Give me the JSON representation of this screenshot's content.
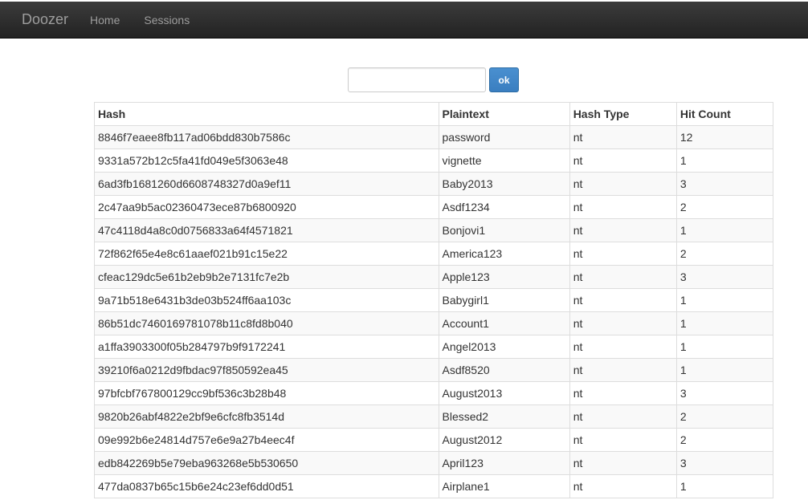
{
  "navbar": {
    "brand": "Doozer",
    "links": [
      "Home",
      "Sessions"
    ]
  },
  "search": {
    "value": "",
    "placeholder": "",
    "button_label": "ok",
    "button_color": "#428bca"
  },
  "table": {
    "headers": [
      "Hash",
      "Plaintext",
      "Hash Type",
      "Hit Count"
    ],
    "rows": [
      [
        "8846f7eaee8fb117ad06bdd830b7586c",
        "password",
        "nt",
        "12"
      ],
      [
        "9331a572b12c5fa41fd049e5f3063e48",
        "vignette",
        "nt",
        "1"
      ],
      [
        "6ad3fb1681260d6608748327d0a9ef11",
        "Baby2013",
        "nt",
        "3"
      ],
      [
        "2c47aa9b5ac02360473ece87b6800920",
        "Asdf1234",
        "nt",
        "2"
      ],
      [
        "47c4118d4a8c0d0756833a64f4571821",
        "Bonjovi1",
        "nt",
        "1"
      ],
      [
        "72f862f65e4e8c61aaef021b91c15e22",
        "America123",
        "nt",
        "2"
      ],
      [
        "cfeac129dc5e61b2eb9b2e7131fc7e2b",
        "Apple123",
        "nt",
        "3"
      ],
      [
        "9a71b518e6431b3de03b524ff6aa103c",
        "Babygirl1",
        "nt",
        "1"
      ],
      [
        "86b51dc7460169781078b11c8fd8b040",
        "Account1",
        "nt",
        "1"
      ],
      [
        "a1ffa3903300f05b284797b9f9172241",
        "Angel2013",
        "nt",
        "1"
      ],
      [
        "39210f6a0212d9fbdac97f850592ea45",
        "Asdf8520",
        "nt",
        "1"
      ],
      [
        "97bfcbf767800129cc9bf536c3b28b48",
        "August2013",
        "nt",
        "3"
      ],
      [
        "9820b26abf4822e2bf9e6cfc8fb3514d",
        "Blessed2",
        "nt",
        "2"
      ],
      [
        "09e992b6e24814d757e6e9a27b4eec4f",
        "August2012",
        "nt",
        "2"
      ],
      [
        "edb842269b5e79eba963268e5b530650",
        "April123",
        "nt",
        "3"
      ],
      [
        "477da0837b65c15b6e24c23ef6dd0d51",
        "Airplane1",
        "nt",
        "1"
      ]
    ]
  }
}
